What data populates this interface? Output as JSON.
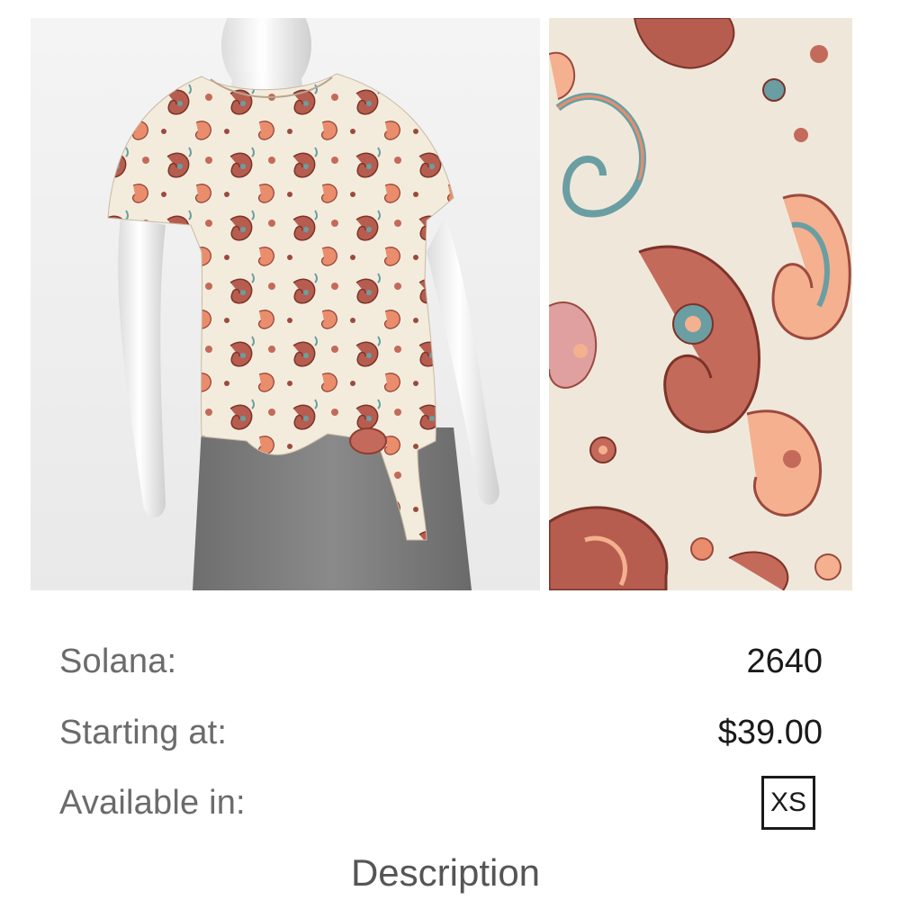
{
  "product": {
    "main_image_alt": "mannequin-wearing-paisley-tie-front-top",
    "swatch_image_alt": "paisley-fabric-swatch"
  },
  "details": {
    "style_label": "Solana:",
    "style_value": "2640",
    "price_label": "Starting at:",
    "price_value": "$39.00",
    "sizes_label": "Available in:",
    "sizes": [
      "XS"
    ]
  },
  "description_heading": "Description",
  "colors": {
    "cream": "#efe8da",
    "brick": "#9b4a3f",
    "coral": "#e98d6c",
    "peach": "#f4b08f",
    "teal": "#6a9ea2",
    "pant_gray": "#7a7a7a"
  }
}
